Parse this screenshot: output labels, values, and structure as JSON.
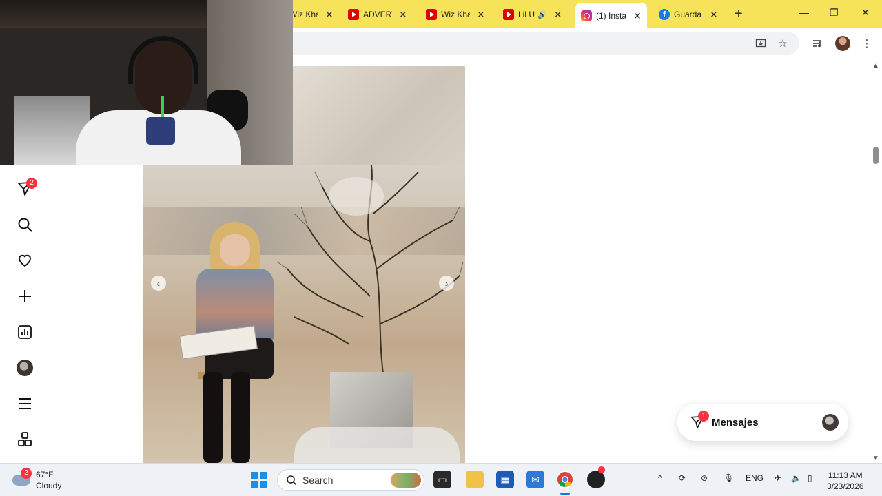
{
  "browser": {
    "tabs": [
      {
        "title": "Wiz Kha",
        "icon": "youtube-icon"
      },
      {
        "title": "ADVERT",
        "icon": "youtube-icon"
      },
      {
        "title": "Wiz Kha",
        "icon": "youtube-icon"
      },
      {
        "title": "Lil U",
        "icon": "youtube-icon",
        "audio": true
      },
      {
        "title": "(1) Insta",
        "icon": "instagram-icon",
        "active": true
      },
      {
        "title": "Guarda",
        "icon": "facebook-icon"
      }
    ],
    "new_tab_symbol": "+",
    "window_controls": {
      "minimize": "—",
      "restore": "❐",
      "close": "✕"
    }
  },
  "sidebar": {
    "items": [
      {
        "name": "messages",
        "badge": "2"
      },
      {
        "name": "search"
      },
      {
        "name": "notifications"
      },
      {
        "name": "create"
      },
      {
        "name": "dashboard"
      },
      {
        "name": "profile"
      },
      {
        "name": "more"
      },
      {
        "name": "apps"
      }
    ]
  },
  "post": {
    "prev_symbol": "‹",
    "next_symbol": "›"
  },
  "messages_pill": {
    "label": "Mensajes",
    "badge": "1"
  },
  "taskbar": {
    "weather": {
      "temp": "67°F",
      "condition": "Cloudy",
      "badge": "2"
    },
    "search_label": "Search",
    "language": "ENG",
    "time": "11:13 AM",
    "date": "3/23/2026"
  },
  "colors": {
    "tab_strip": "#f6e35a",
    "badge": "#ff3040",
    "accent": "#1a73e8"
  }
}
